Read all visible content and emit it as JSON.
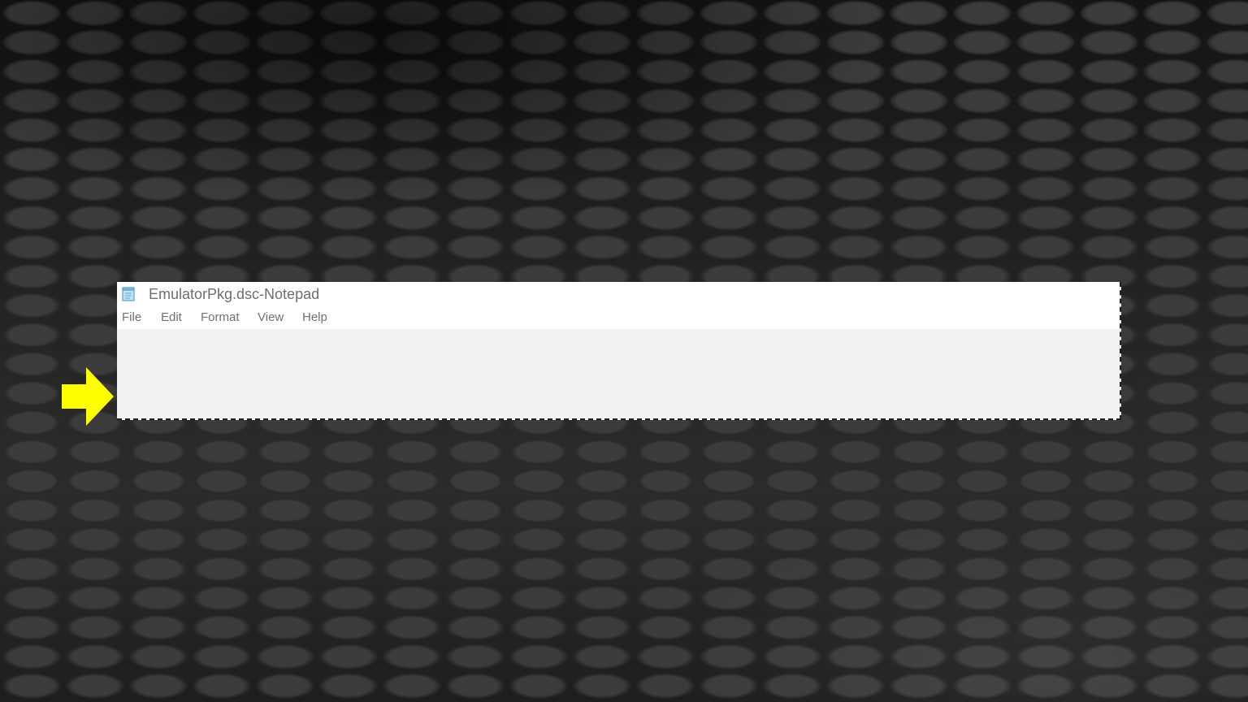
{
  "window": {
    "title": "EmulatorPkg.dsc-Notepad",
    "icon": "notepad-icon"
  },
  "menu": {
    "file": "File",
    "edit": "Edit",
    "format": "Format",
    "view": "View",
    "help": "Help"
  },
  "editor": {
    "content": ""
  },
  "annotation": {
    "icon": "arrow-right-icon",
    "color": "#ffff00"
  }
}
